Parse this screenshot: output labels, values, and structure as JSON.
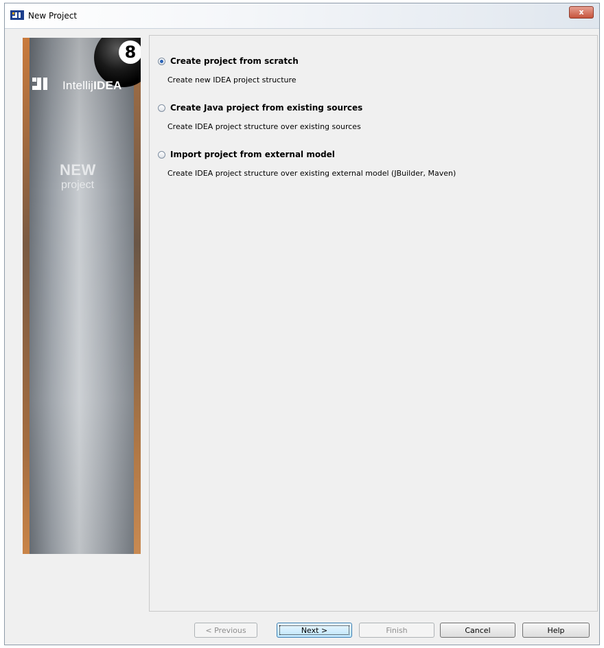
{
  "window": {
    "title": "New Project",
    "close_glyph": "x",
    "icon": "intellij-idea-icon"
  },
  "banner": {
    "logo_light": "Intellij",
    "logo_bold": "IDEA",
    "eightball_number": "8",
    "new_word": "NEW",
    "project_word": "project"
  },
  "options": [
    {
      "title": "Create project from scratch",
      "description": "Create new IDEA project structure",
      "selected": true
    },
    {
      "title": "Create Java project from existing sources",
      "description": "Create IDEA project structure over existing sources",
      "selected": false
    },
    {
      "title": "Import project from external model",
      "description": "Create IDEA project structure over existing external model (JBuilder, Maven)",
      "selected": false
    }
  ],
  "buttons": {
    "previous": "< Previous",
    "next": "Next >",
    "finish": "Finish",
    "cancel": "Cancel",
    "help": "Help"
  },
  "colors": {
    "radio_selected": "#2b64b8",
    "close_button": "#c6543c",
    "focused_button": "#3c7fb1"
  }
}
